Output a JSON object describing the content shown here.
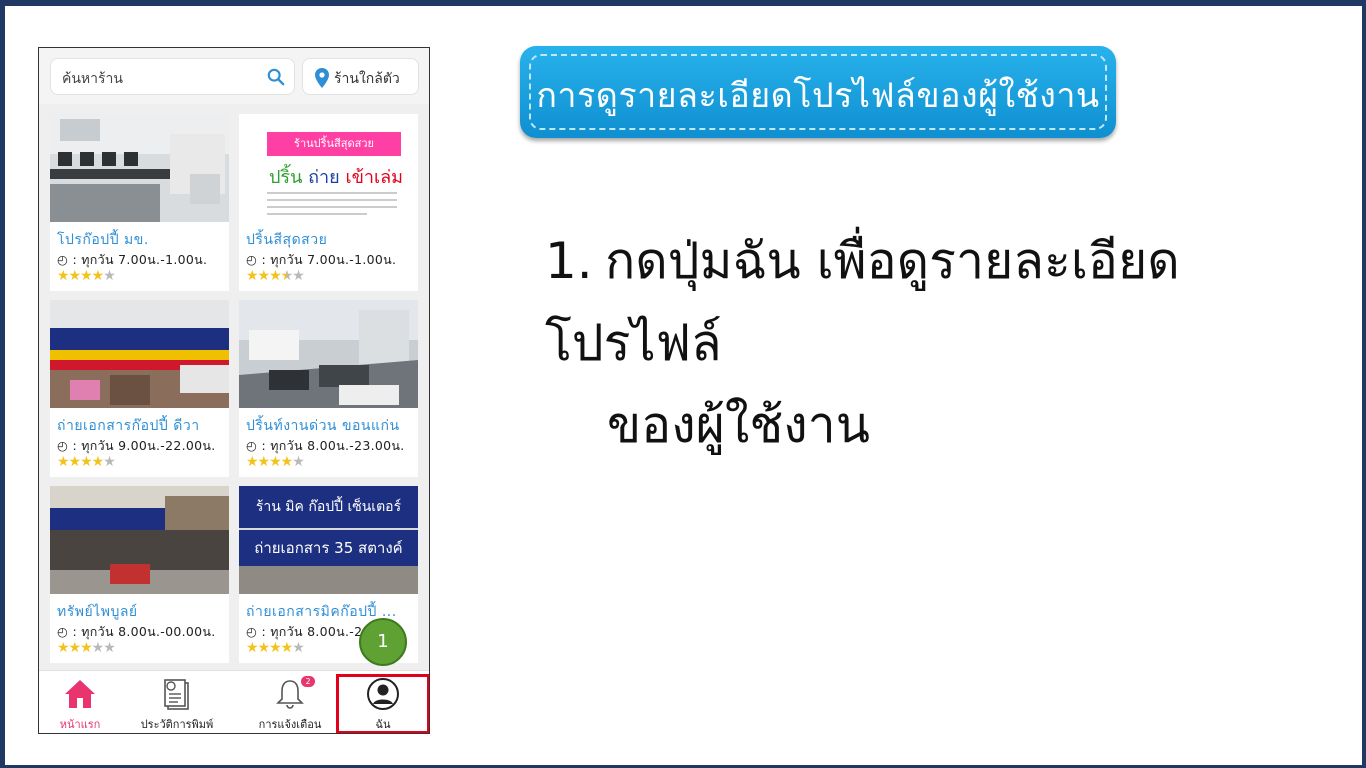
{
  "search": {
    "placeholder": "ค้นหาร้าน",
    "nearby_label": "ร้านใกล้ตัว"
  },
  "shops": [
    {
      "name": "โปรก๊อปปี้ มข.",
      "hours": "◴ : ทุกวัน 7.00น.-1.00น.",
      "rating": 4
    },
    {
      "name": "ปริ้นสีสุดสวย",
      "hours": "◴ : ทุกวัน 7.00น.-1.00น.",
      "rating": 3.5,
      "sign": {
        "title": "ร้านปริ้นสีสุดสวย",
        "w1": "ปริ้น",
        "w2": "ถ่าย",
        "w3": "เข้าเล่ม"
      }
    },
    {
      "name": "ถ่ายเอกสารก๊อปปี้ ดีวา",
      "hours": "◴ : ทุกวัน 9.00น.-22.00น.",
      "rating": 4
    },
    {
      "name": "ปริ้นท์งานด่วน ขอนแก่น",
      "hours": "◴ : ทุกวัน 8.00น.-23.00น.",
      "rating": 4
    },
    {
      "name": "ทรัพย์ไพบูลย์",
      "hours": "◴ : ทุกวัน 8.00น.-00.00น.",
      "rating": 3
    },
    {
      "name": "ถ่ายเอกสารมิคก๊อปปี้ ...",
      "hours": "◴ : ทุกวัน 8.00น.-2",
      "rating": 4,
      "sign": {
        "line1": "ร้าน มิค ก๊อปปี้ เซ็นเตอร์",
        "line2": "ถ่ายเอกสาร 35 สตางค์"
      }
    }
  ],
  "nav": {
    "home": "หน้าแรก",
    "history": "ประวัติการพิมพ์",
    "notifications": "การแจ้งเตือน",
    "notification_count": "2",
    "me": "ฉัน"
  },
  "step_marker": "1",
  "banner_title": "การดูรายละเอียดโปรไฟล์ของผู้ใช้งาน",
  "instruction": {
    "number": "1.",
    "line1": "กดปุ่มฉัน เพื่อดูรายละเอียดโปรไฟล์",
    "line2": "ของผู้ใช้งาน"
  },
  "colors": {
    "accent_pink": "#e8356d",
    "link_blue": "#2f8fd6",
    "star": "#f3c21b",
    "highlight_red": "#e3001b",
    "banner_blue": "#1aa3e0",
    "step_green": "#5fa233"
  }
}
